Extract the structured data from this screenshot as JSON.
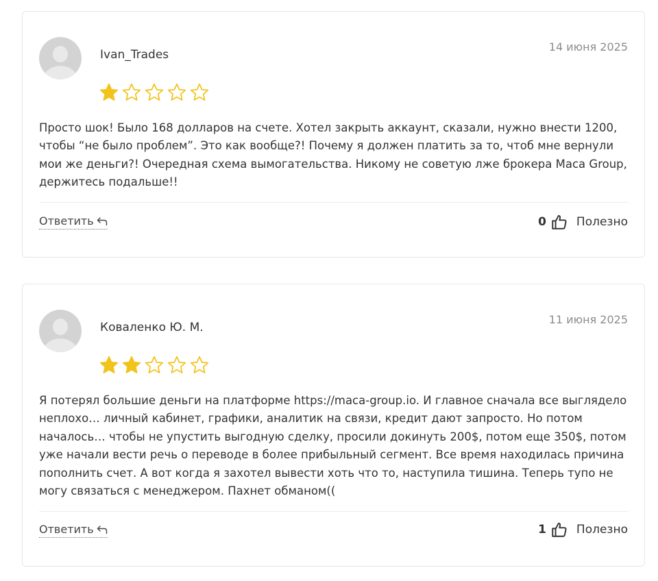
{
  "reviews": [
    {
      "author": "Ivan_Trades",
      "date": "14 июня 2025",
      "rating": 1,
      "max_rating": 5,
      "text": "Просто шок! Было 168 долларов на счете. Хотел закрыть аккаунт, сказали, нужно внести 1200, чтобы “не было проблем”. Это как вообще?! Почему я должен платить за то, чтоб мне вернули мои же деньги?! Очередная схема вымогательства. Никому не советую лже брокера Maca Group, держитесь подальше!!",
      "reply_label": "Ответить",
      "helpful_count": "0",
      "helpful_label": "Полезно"
    },
    {
      "author": "Коваленко Ю. М.",
      "date": "11 июня 2025",
      "rating": 2,
      "max_rating": 5,
      "text": "Я потерял большие деньги на платформе https://maca-group.io. И главное сначала все выглядело неплохо… личный кабинет, графики, аналитик на связи, кредит дают запросто. Но потом началось… чтобы не упустить выгодную сделку, просили докинуть 200$, потом еще 350$, потом уже начали вести речь о переводе в более прибыльный сегмент. Все время находилась причина пополнить счет. А вот когда я захотел вывести хоть что то, наступила тишина. Теперь тупо не могу связаться с менеджером. Пахнет обманом((",
      "reply_label": "Ответить",
      "helpful_count": "1",
      "helpful_label": "Полезно"
    }
  ],
  "colors": {
    "star_filled": "#F2C31A",
    "star_outline": "#F2C31A",
    "border": "#E6E6E6",
    "date": "#8C8C8C"
  },
  "icons": {
    "reply": "reply-arrow-icon",
    "helpful": "thumbs-up-icon",
    "star": "star-icon",
    "avatar": "user-avatar-icon"
  }
}
